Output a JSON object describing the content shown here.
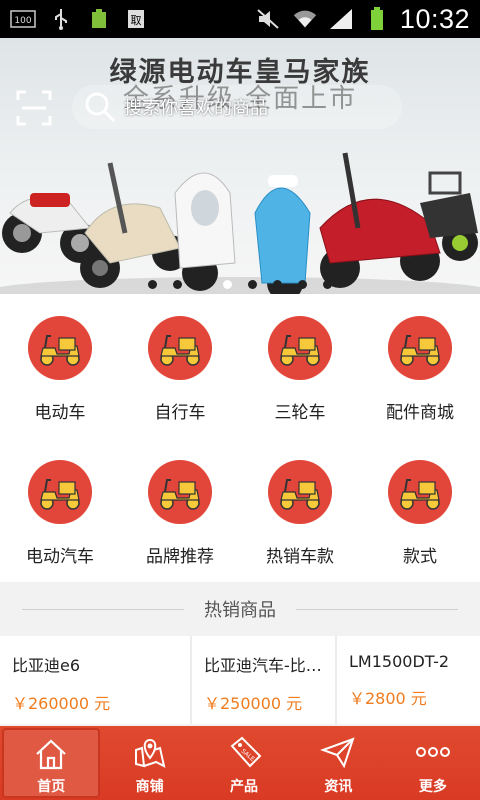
{
  "statusbar": {
    "time": "10:32",
    "battery_percent": "100%",
    "icons": [
      "notification-100-icon",
      "usb-icon",
      "battery-100-icon",
      "clipboard-icon",
      "mute-icon",
      "wifi-icon",
      "signal-icon",
      "battery-icon"
    ]
  },
  "banner": {
    "title": "绿源电动车皇马家族",
    "subtitle": "全系升级 全面上市",
    "search_placeholder": "搜索你喜欢的商品",
    "slide_count": 8,
    "active_slide": 3
  },
  "categories": [
    {
      "label": "电动车",
      "icon": "scooter-icon"
    },
    {
      "label": "自行车",
      "icon": "scooter-icon"
    },
    {
      "label": "三轮车",
      "icon": "scooter-icon"
    },
    {
      "label": "配件商城",
      "icon": "scooter-icon"
    },
    {
      "label": "电动汽车",
      "icon": "scooter-icon"
    },
    {
      "label": "品牌推荐",
      "icon": "scooter-icon"
    },
    {
      "label": "热销车款",
      "icon": "scooter-icon"
    },
    {
      "label": "款式",
      "icon": "scooter-icon"
    }
  ],
  "hot": {
    "title": "热销商品",
    "products": [
      {
        "name": "比亚迪e6",
        "price": "￥260000 元"
      },
      {
        "name": "比亚迪汽车-比…",
        "price": "￥250000 元"
      },
      {
        "name": "LM1500DT-2",
        "price": "￥2800 元"
      }
    ]
  },
  "nav": {
    "items": [
      {
        "label": "首页",
        "icon": "home-icon"
      },
      {
        "label": "商铺",
        "icon": "map-shop-icon"
      },
      {
        "label": "产品",
        "icon": "sale-tag-icon"
      },
      {
        "label": "资讯",
        "icon": "paper-plane-icon"
      },
      {
        "label": "更多",
        "icon": "more-dots-icon"
      }
    ]
  },
  "colors": {
    "accent": "#e2463a",
    "price": "#f07c1e",
    "nav_bg": "#d93a24"
  }
}
